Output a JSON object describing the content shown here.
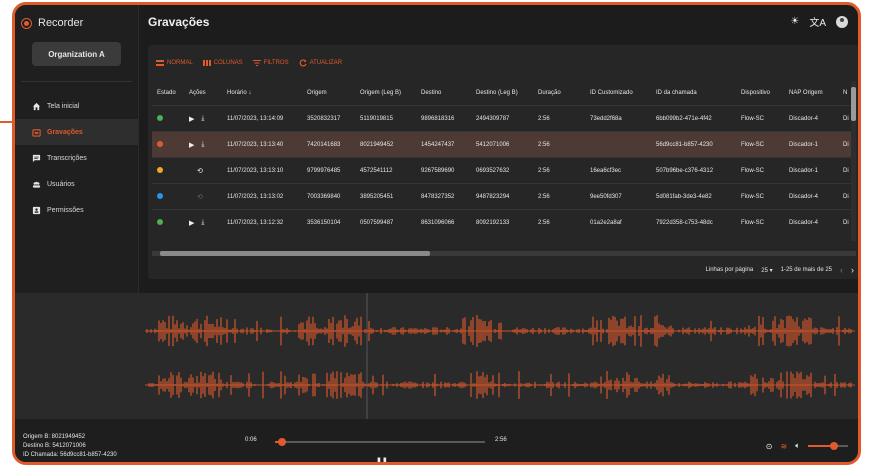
{
  "app": {
    "name": "Recorder",
    "organization": "Organization A"
  },
  "sidebar": {
    "items": [
      {
        "label": "Tela inicial",
        "icon": "home-icon",
        "active": false
      },
      {
        "label": "Gravações",
        "icon": "recordings-icon",
        "active": true
      },
      {
        "label": "Transcrições",
        "icon": "transcript-icon",
        "active": false
      },
      {
        "label": "Usuários",
        "icon": "users-icon",
        "active": false
      },
      {
        "label": "Permissões",
        "icon": "permissions-icon",
        "active": false
      }
    ]
  },
  "page": {
    "title": "Gravações"
  },
  "toolbar": {
    "normal": "NORMAL",
    "columns": "COLUNAS",
    "filters": "FILTROS",
    "refresh": "ATUALIZAR"
  },
  "table": {
    "columns": [
      "Estado",
      "Ações",
      "Horário ↓",
      "Origem",
      "Origem (Leg B)",
      "Destino",
      "Destino (Leg B)",
      "Duração",
      "ID Customizado",
      "ID da chamada",
      "Dispositivo",
      "NAP Origem",
      "N"
    ],
    "rows": [
      {
        "status": "#4caf50",
        "actions": "play-download",
        "time": "11/07/2023, 13:14:09",
        "origem": "3520832317",
        "origem_b": "5119019815",
        "destino": "9896818316",
        "destino_b": "2494309787",
        "duracao": "2:56",
        "custom_id": "73edd2f68a",
        "call_id": "6bb099b2-471e-4f42",
        "device": "Flow-SC",
        "nap": "Discador-4",
        "n": "Di",
        "selected": false
      },
      {
        "status": "#e05a2b",
        "actions": "play-download",
        "time": "11/07/2023, 13:13:40",
        "origem": "7420141683",
        "origem_b": "8021949452",
        "destino": "1454247437",
        "destino_b": "5412071006",
        "duracao": "2:56",
        "custom_id": "",
        "call_id": "56d9cc81-b857-4230",
        "device": "Flow-SC",
        "nap": "Discador-1",
        "n": "Di",
        "selected": true
      },
      {
        "status": "#f5a623",
        "actions": "history",
        "time": "11/07/2023, 13:13:10",
        "origem": "9799976485",
        "origem_b": "4572541112",
        "destino": "9267589690",
        "destino_b": "0693527632",
        "duracao": "2:56",
        "custom_id": "16ea6cf3ec",
        "call_id": "507b96be-c376-4312",
        "device": "Flow-SC",
        "nap": "Discador-1",
        "n": "Di",
        "selected": false
      },
      {
        "status": "#2196f3",
        "actions": "history-dim",
        "time": "11/07/2023, 13:13:02",
        "origem": "7003369840",
        "origem_b": "3895205451",
        "destino": "8478327352",
        "destino_b": "9487823294",
        "duracao": "2:56",
        "custom_id": "9ee50fd307",
        "call_id": "5d081fab-3de3-4e82",
        "device": "Flow-SC",
        "nap": "Discador-4",
        "n": "Di",
        "selected": false
      },
      {
        "status": "#4caf50",
        "actions": "play-download",
        "time": "11/07/2023, 13:12:32",
        "origem": "3536150104",
        "origem_b": "0507599487",
        "destino": "8631096066",
        "destino_b": "8092192133",
        "duracao": "2:56",
        "custom_id": "01a2e2a8af",
        "call_id": "7922d358-c753-48dc",
        "device": "Flow-SC",
        "nap": "Discador-4",
        "n": "Di",
        "selected": false
      }
    ]
  },
  "pagination": {
    "rows_label": "Linhas por página",
    "rows_value": "25",
    "range": "1-25 de mais de 25"
  },
  "player": {
    "origem_b": "Origem B: 8021949452",
    "destino_b": "Destino B: 5412071006",
    "call_id": "ID Chamada: 56d9cc81-b857-4230",
    "current_time": "0:06",
    "total_time": "2:56",
    "progress_fraction": 0.034,
    "volume_fraction": 0.65
  },
  "colors": {
    "accent": "#e05a2b",
    "background": "#1c1c1c",
    "panel": "#262626",
    "selected_row": "#4e3a34"
  }
}
